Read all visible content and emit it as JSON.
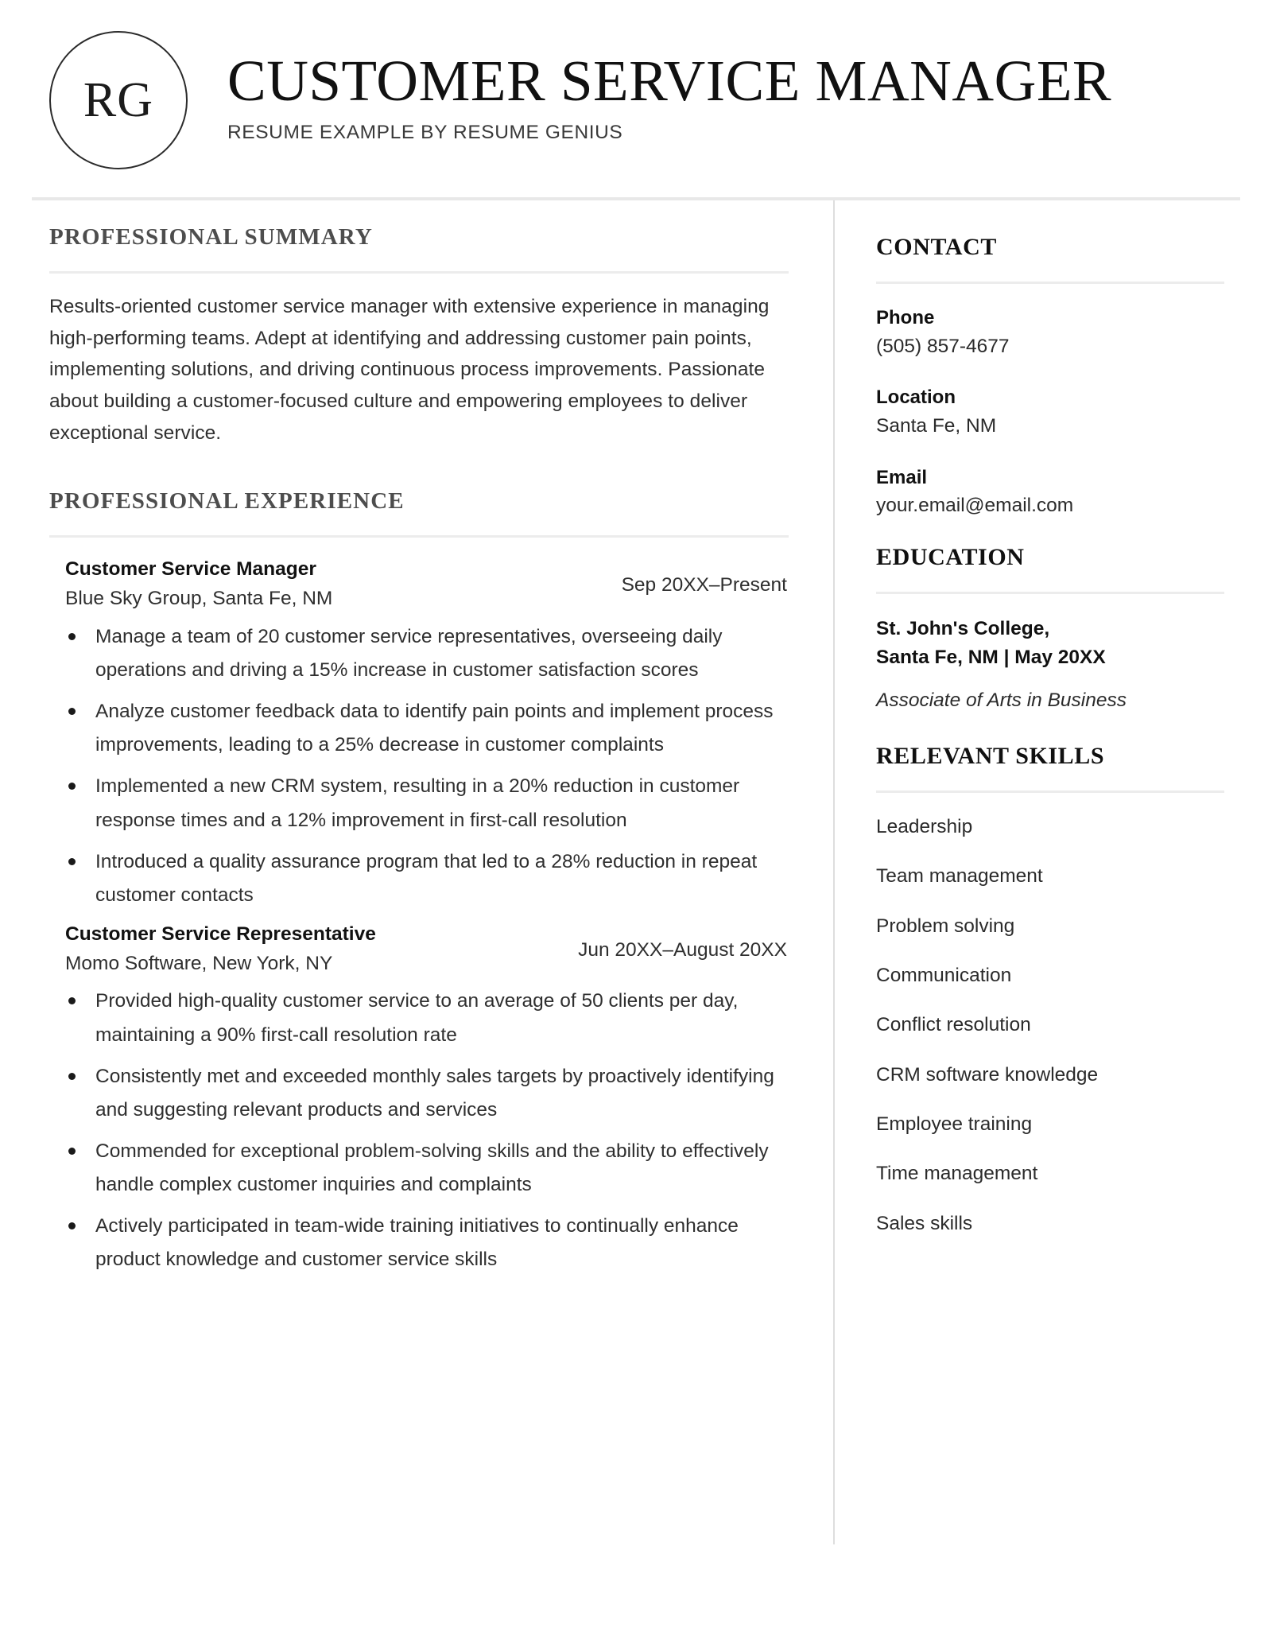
{
  "header": {
    "logo_initials": "RG",
    "title": "CUSTOMER SERVICE MANAGER",
    "subtitle": "RESUME EXAMPLE BY RESUME GENIUS"
  },
  "main": {
    "summary_heading": "PROFESSIONAL SUMMARY",
    "summary_text": "Results-oriented customer service manager with extensive experience in managing high-performing teams. Adept at identifying and addressing customer pain points, implementing solutions, and driving continuous process improvements. Passionate about building a customer-focused culture and empowering employees to deliver exceptional service.",
    "experience_heading": "PROFESSIONAL EXPERIENCE",
    "jobs": [
      {
        "title": "Customer Service Manager",
        "organization": "Blue Sky Group, Santa Fe, NM",
        "dates": "Sep 20XX–Present",
        "bullets": [
          "Manage a team of 20 customer service representatives, overseeing daily operations and driving a 15% increase in customer satisfaction scores",
          "Analyze customer feedback data to identify pain points and implement process improvements, leading to a 25% decrease in customer complaints",
          "Implemented a new CRM system, resulting in a 20% reduction in customer response times and a 12% improvement in first-call resolution",
          "Introduced a quality assurance program that led to a 28% reduction in repeat customer contacts"
        ]
      },
      {
        "title": "Customer Service Representative",
        "organization": "Momo Software, New York, NY",
        "dates": "Jun 20XX–August 20XX",
        "bullets": [
          "Provided high-quality customer service to an average of 50 clients per day, maintaining a 90% first-call resolution rate",
          "Consistently met and exceeded monthly sales targets by proactively identifying and suggesting relevant products and services",
          "Commended for exceptional problem-solving skills and the ability to effectively handle complex customer inquiries and complaints",
          "Actively participated in team-wide training initiatives to continually enhance product knowledge and customer service skills"
        ]
      }
    ]
  },
  "sidebar": {
    "contact_heading": "CONTACT",
    "contact": [
      {
        "label": "Phone",
        "value": "(505) 857-4677"
      },
      {
        "label": "Location",
        "value": "Santa Fe, NM"
      },
      {
        "label": "Email",
        "value": "your.email@email.com"
      }
    ],
    "education_heading": "EDUCATION",
    "education": {
      "school_line1": "St. John's College,",
      "school_line2": "Santa Fe, NM | May 20XX",
      "degree": "Associate of Arts in Business"
    },
    "skills_heading": "RELEVANT SKILLS",
    "skills": [
      "Leadership",
      "Team management",
      "Problem solving",
      "Communication",
      "Conflict resolution",
      "CRM software knowledge",
      "Employee training",
      "Time management",
      "Sales skills"
    ]
  }
}
